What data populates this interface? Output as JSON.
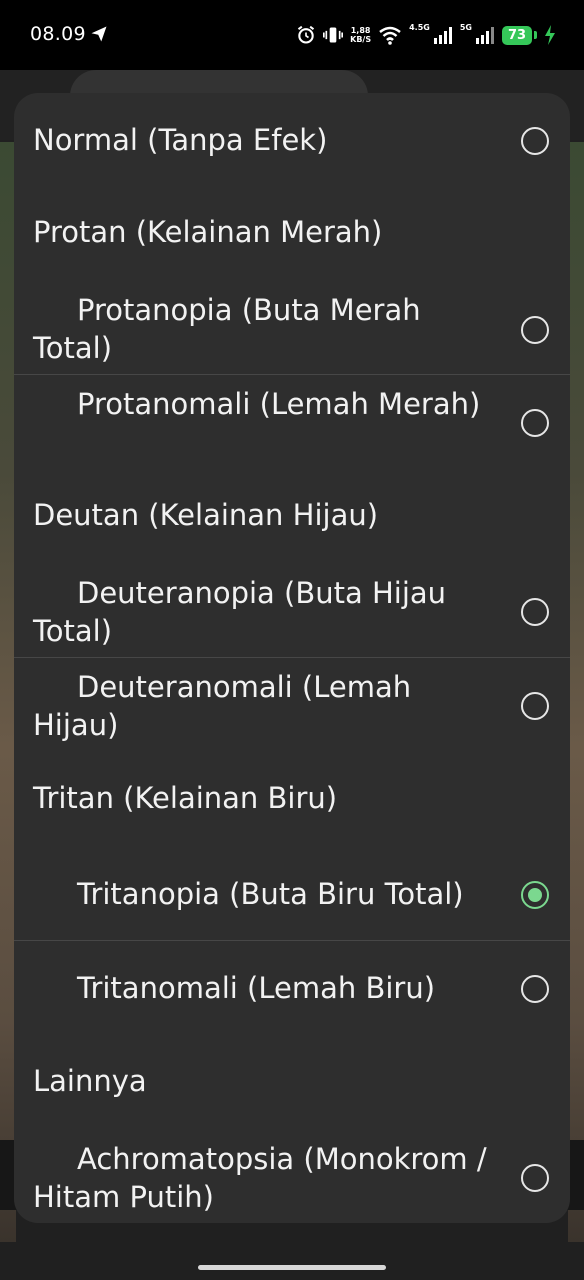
{
  "status_bar": {
    "time": "08.09",
    "net_speed": "1,88",
    "net_unit": "KB/S",
    "sim1_label": "4.5G",
    "sim2_label": "5G",
    "battery": "73"
  },
  "dialog": {
    "selected": "Tritanopia (Buta Biru Total)",
    "accent_color": "#7bd88f",
    "items": [
      {
        "type": "option",
        "label": "Normal (Tanpa Efek)",
        "checked": false
      },
      {
        "type": "category",
        "label": "Protan (Kelainan Merah)"
      },
      {
        "type": "option",
        "label": "Protanopia (Buta Merah Total)",
        "checked": false
      },
      {
        "type": "option",
        "label": "Protanomali (Lemah Merah)",
        "checked": false
      },
      {
        "type": "category",
        "label": "Deutan (Kelainan Hijau)"
      },
      {
        "type": "option",
        "label": "Deuteranopia (Buta Hijau Total)",
        "checked": false
      },
      {
        "type": "option",
        "label": "Deuteranomali (Lemah Hijau)",
        "checked": false
      },
      {
        "type": "category",
        "label": "Tritan (Kelainan Biru)"
      },
      {
        "type": "option",
        "label": "Tritanopia (Buta Biru Total)",
        "checked": true
      },
      {
        "type": "option",
        "label": "Tritanomali (Lemah Biru)",
        "checked": false
      },
      {
        "type": "category",
        "label": "Lainnya"
      },
      {
        "type": "option",
        "label": "Achromatopsia (Monokrom / Hitam Putih)",
        "checked": false
      }
    ]
  }
}
